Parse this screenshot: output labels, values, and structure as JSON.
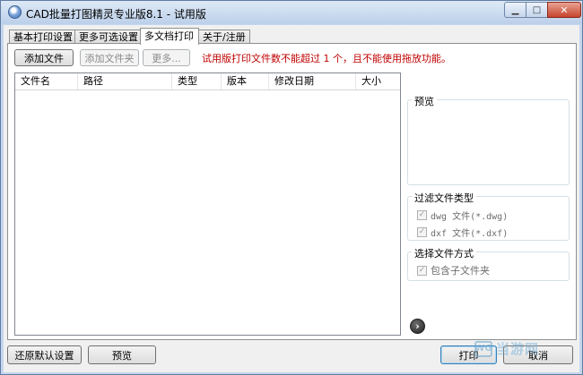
{
  "window": {
    "title": "CAD批量打图精灵专业版8.1 - 试用版",
    "app_icon": "globe-icon",
    "controls": {
      "minimize_icon": "minimize-icon",
      "maximize_icon": "maximize-icon",
      "close_icon": "close-icon"
    }
  },
  "tabs": [
    {
      "label": "基本打印设置",
      "active": false
    },
    {
      "label": "更多可选设置",
      "active": false
    },
    {
      "label": "多文档打印",
      "active": true
    },
    {
      "label": "关于/注册",
      "active": false
    }
  ],
  "toolbar": {
    "add_file": "添加文件",
    "add_folder": "添加文件夹",
    "more": "更多...",
    "warning": "试用版打印文件数不能超过 1 个，且不能使用拖放功能。"
  },
  "file_list": {
    "columns": [
      "文件名",
      "路径",
      "类型",
      "版本",
      "修改日期",
      "大小"
    ],
    "rows": []
  },
  "preview": {
    "legend": "预览"
  },
  "filter_group": {
    "legend": "过滤文件类型",
    "items": [
      {
        "label": "dwg 文件(*.dwg)",
        "checked": true,
        "enabled": false
      },
      {
        "label": "dxf 文件(*.dxf)",
        "checked": true,
        "enabled": false
      }
    ]
  },
  "select_group": {
    "legend": "选择文件方式",
    "items": [
      {
        "label": "包含子文件夹",
        "checked": true,
        "enabled": false
      }
    ]
  },
  "expand_icon": "chevron-right-icon",
  "bottom": {
    "restore_defaults": "还原默认设置",
    "preview": "预览",
    "print": "打印",
    "cancel": "取消"
  },
  "watermark": {
    "logo_text": "WG",
    "text": "当游网"
  }
}
